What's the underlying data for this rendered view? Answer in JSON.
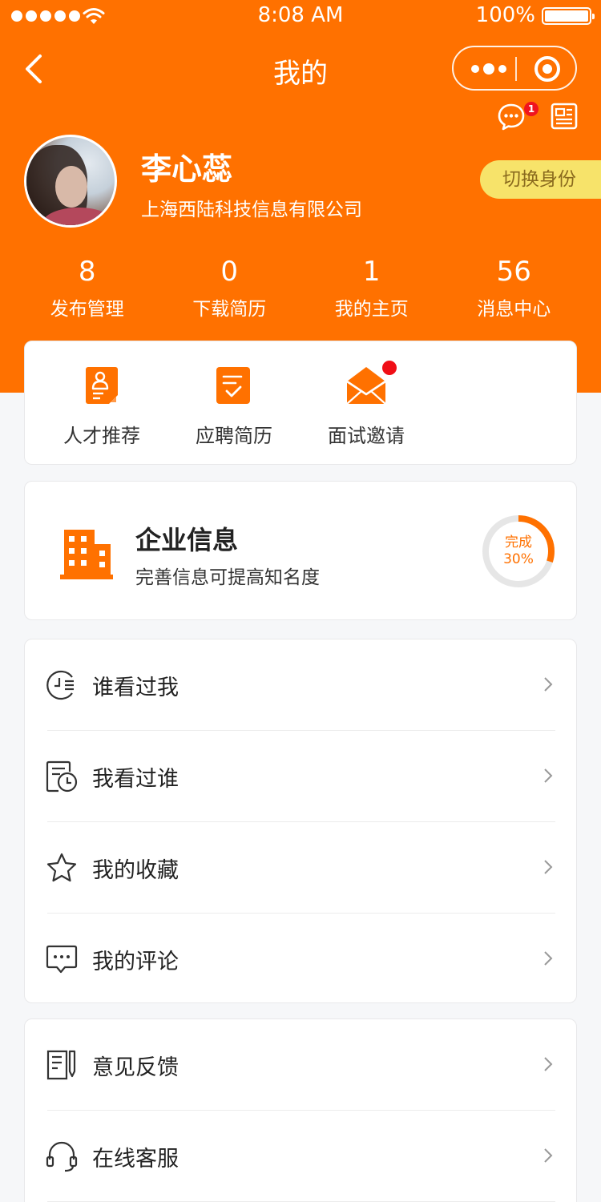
{
  "status_bar": {
    "time": "8:08 AM",
    "battery": "100%"
  },
  "nav": {
    "title": "我的"
  },
  "header": {
    "chat_badge_count": "1"
  },
  "profile": {
    "name": "李心蕊",
    "company": "上海西陆科技信息有限公司",
    "switch_label": "切换身份"
  },
  "stats": [
    {
      "value": "8",
      "label": "发布管理"
    },
    {
      "value": "0",
      "label": "下载简历"
    },
    {
      "value": "1",
      "label": "我的主页"
    },
    {
      "value": "56",
      "label": "消息中心"
    }
  ],
  "quick_actions": [
    {
      "label": "人才推荐",
      "icon": "talent-doc-icon"
    },
    {
      "label": "应聘简历",
      "icon": "resume-check-icon"
    },
    {
      "label": "面试邀请",
      "icon": "envelope-icon",
      "has_dot": true
    }
  ],
  "company_info": {
    "title": "企业信息",
    "subtitle": "完善信息可提高知名度",
    "progress_label": "完成",
    "progress_text": "30%",
    "progress": 0.3
  },
  "menu": [
    {
      "label": "谁看过我",
      "icon": "visitor-clock-icon"
    },
    {
      "label": "我看过谁",
      "icon": "history-doc-icon"
    },
    {
      "label": "我的收藏",
      "icon": "star-icon"
    },
    {
      "label": "我的评论",
      "icon": "comment-icon"
    }
  ],
  "menu2": [
    {
      "label": "意见反馈",
      "icon": "feedback-icon"
    },
    {
      "label": "在线客服",
      "icon": "headset-icon"
    }
  ],
  "colors": {
    "brand": "#ff7100",
    "switch_bg": "#f7e36a",
    "badge": "#f0141e",
    "page_bg": "#f6f7f9"
  }
}
